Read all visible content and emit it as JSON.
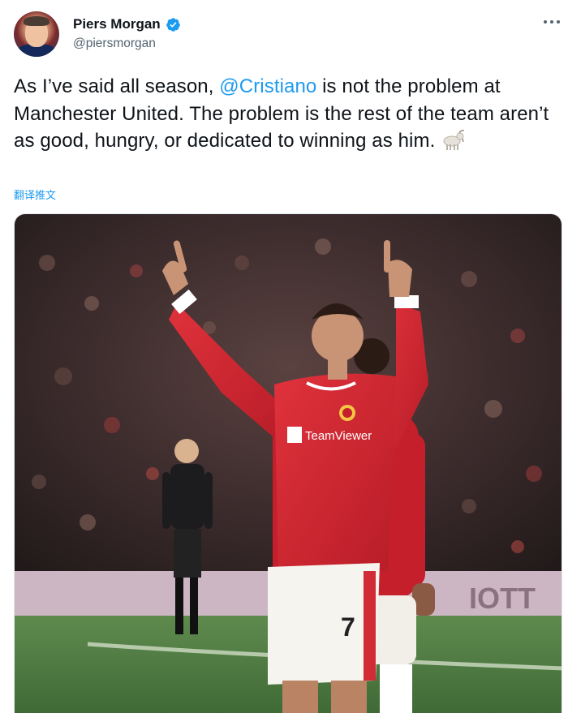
{
  "tweet": {
    "author": {
      "display_name": "Piers Morgan",
      "handle": "@piersmorgan",
      "verified": true,
      "avatar_icon": "user-avatar"
    },
    "text": {
      "before_mention": "As I’ve said all season, ",
      "mention": "@Cristiano",
      "after_mention": " is not the problem at Manchester United. The problem is the rest of the team aren’t as good, hungry, or dedicated to winning as him.",
      "emoji": "goat"
    },
    "translate_label": "翻译推文",
    "more_icon": "more-horizontal-icon",
    "media": {
      "type": "photo",
      "jersey_sponsor": "TeamViewer",
      "shirt_number": "7",
      "board_text": "IOTT"
    }
  },
  "colors": {
    "link": "#1d9bf0",
    "text": "#0f1419",
    "secondary": "#536471",
    "verified": "#1d9bf0",
    "jersey": "#d4212e"
  }
}
